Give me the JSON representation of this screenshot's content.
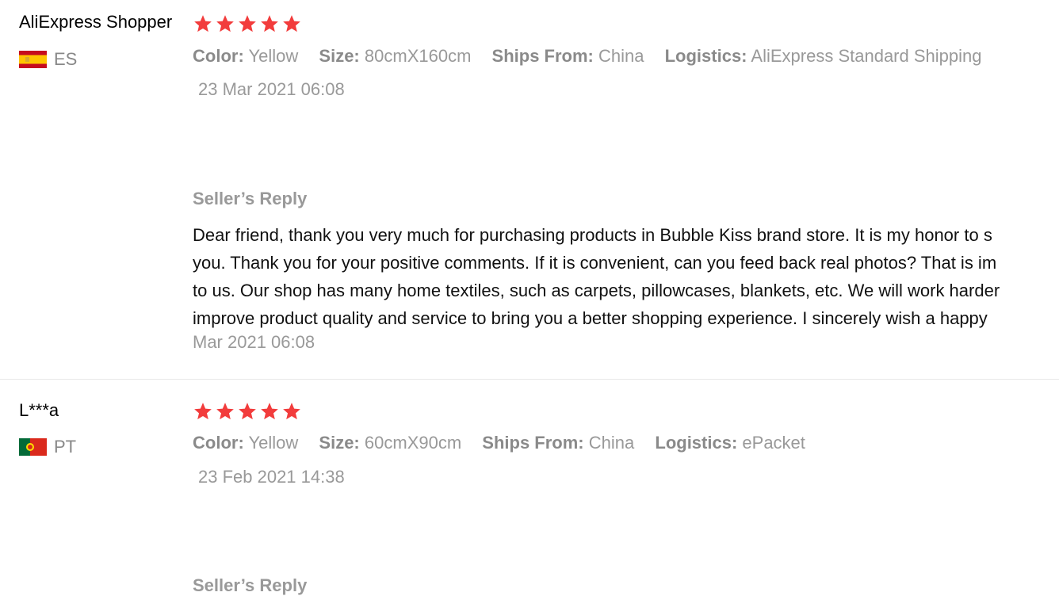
{
  "reviews": [
    {
      "user": "AliExpress Shopper",
      "country_code": "ES",
      "flag": "spain-flag",
      "rating": 5,
      "attributes": [
        {
          "key": "Color:",
          "value": "Yellow"
        },
        {
          "key": "Size:",
          "value": "80cmX160cm"
        },
        {
          "key": "Ships From:",
          "value": "China"
        },
        {
          "key": "Logistics:",
          "value": "AliExpress Standard Shipping"
        }
      ],
      "date": "23 Mar 2021 06:08",
      "reply_title": "Seller’s Reply",
      "reply_lines": [
        "Dear friend, thank you very much for purchasing products in Bubble Kiss brand store. It is my honor to s",
        "you. Thank you for your positive comments. If it is convenient, can you feed back real photos? That is im",
        "to us. Our shop has many home textiles, such as carpets, pillowcases, blankets, etc. We will work harder",
        "improve product quality and service to bring you a better shopping experience. I sincerely wish a happy"
      ],
      "reply_date": "Mar 2021 06:08"
    },
    {
      "user": "L***a",
      "country_code": "PT",
      "flag": "portugal-flag",
      "rating": 5,
      "attributes": [
        {
          "key": "Color:",
          "value": "Yellow"
        },
        {
          "key": "Size:",
          "value": "60cmX90cm"
        },
        {
          "key": "Ships From:",
          "value": "China"
        },
        {
          "key": "Logistics:",
          "value": "ePacket"
        }
      ],
      "date": "23 Feb 2021 14:38",
      "reply_title": "Seller’s Reply"
    }
  ],
  "colors": {
    "star": "#f23c3c",
    "muted_text": "#999999",
    "body_text": "#111111"
  }
}
